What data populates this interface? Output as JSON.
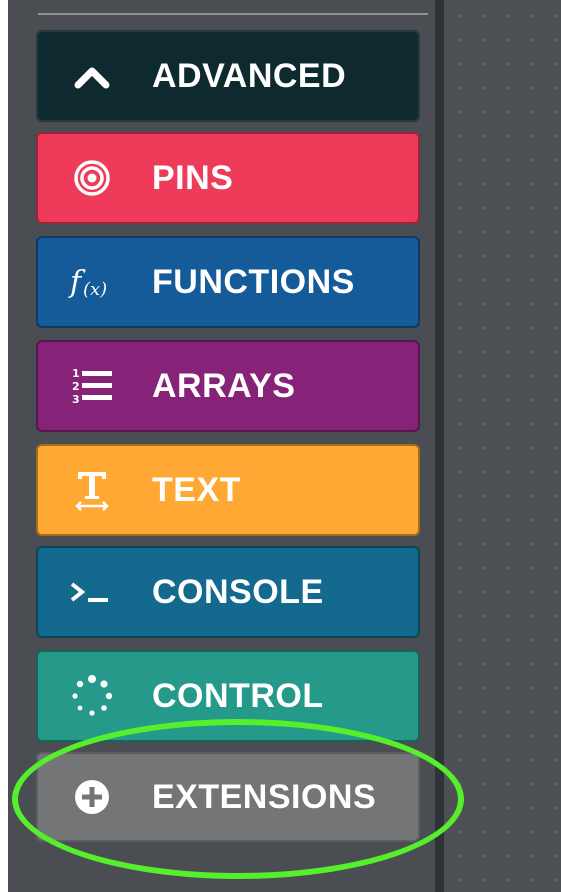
{
  "toolbox": {
    "categories": [
      {
        "id": "advanced",
        "label": "ADVANCED",
        "icon": "chevron-up-icon",
        "color": "#0e2a2e"
      },
      {
        "id": "pins",
        "label": "PINS",
        "icon": "target-icon",
        "color": "#ef3b5a"
      },
      {
        "id": "functions",
        "label": "FUNCTIONS",
        "icon": "function-icon",
        "color": "#155a99"
      },
      {
        "id": "arrays",
        "label": "ARRAYS",
        "icon": "numbered-list-icon",
        "color": "#862277"
      },
      {
        "id": "text",
        "label": "TEXT",
        "icon": "text-size-icon",
        "color": "#ffa834"
      },
      {
        "id": "console",
        "label": "CONSOLE",
        "icon": "terminal-icon",
        "color": "#13698e"
      },
      {
        "id": "control",
        "label": "CONTROL",
        "icon": "spinner-icon",
        "color": "#25998a"
      },
      {
        "id": "extensions",
        "label": "EXTENSIONS",
        "icon": "plus-circle-icon",
        "color": "#737577"
      }
    ]
  },
  "annotation": {
    "highlight_color": "#56ef2b",
    "highlighted_item": "extensions"
  }
}
